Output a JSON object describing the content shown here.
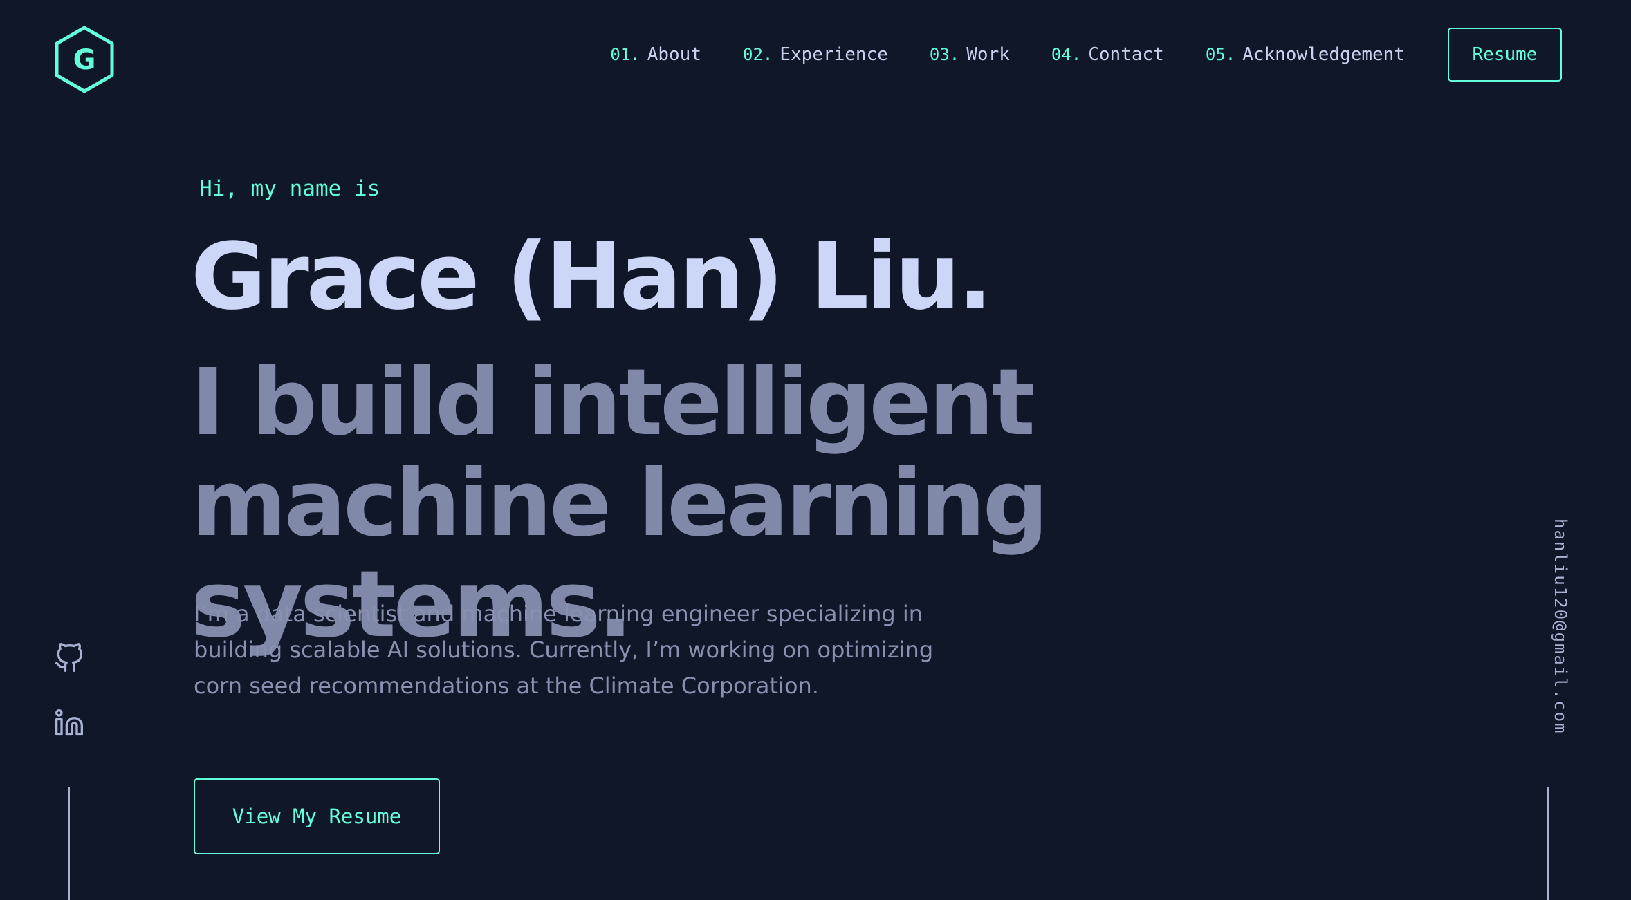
{
  "logo": {
    "letter": "G",
    "icon": "hexagon-logo-icon"
  },
  "nav": {
    "items": [
      {
        "num": "01.",
        "label": "About"
      },
      {
        "num": "02.",
        "label": "Experience"
      },
      {
        "num": "03.",
        "label": "Work"
      },
      {
        "num": "04.",
        "label": "Contact"
      },
      {
        "num": "05.",
        "label": "Acknowledgement"
      }
    ],
    "resume_label": "Resume"
  },
  "hero": {
    "greeting": "Hi, my name is",
    "name": "Grace (Han) Liu.",
    "tagline": "I build intelligent machine learning systems.",
    "intro": "I’m a data scientist and machine learning engineer specializing in building scalable AI solutions. Currently, I’m working on optimizing corn seed recommendations at the Climate Corporation.",
    "cta_label": "View My Resume"
  },
  "social": {
    "icons": [
      "github-icon",
      "linkedin-icon"
    ]
  },
  "email": "hanliu120@gmail.com",
  "colors": {
    "background": "#0f1729",
    "accent": "#64ffda",
    "heading": "#ccd6f6",
    "subheading": "#8189a8",
    "body_text": "#8892b0"
  }
}
